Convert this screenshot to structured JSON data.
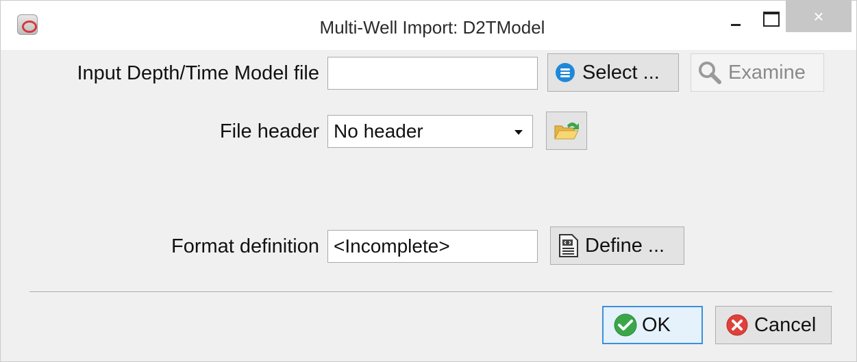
{
  "window": {
    "title": "Multi-Well Import: D2TModel",
    "close_glyph": "×"
  },
  "form": {
    "input_file_label": "Input Depth/Time Model file",
    "input_file_value": "",
    "select_button": "Select ...",
    "examine_button": "Examine",
    "file_header_label": "File header",
    "file_header_value": "No header",
    "format_label": "Format definition",
    "format_value": "<Incomplete>",
    "define_button": "Define ..."
  },
  "footer": {
    "ok_button": "OK",
    "cancel_button": "Cancel"
  },
  "icons": {
    "select": "list-circle-icon",
    "examine": "magnifier-icon",
    "header_open": "folder-open-icon",
    "define": "document-code-icon",
    "ok": "check-circle-icon",
    "cancel": "x-circle-icon"
  },
  "colors": {
    "select_icon": "#1e88d8",
    "ok_icon": "#3aa64a",
    "cancel_icon": "#e0413a",
    "focus_border": "#3c8fdc"
  }
}
